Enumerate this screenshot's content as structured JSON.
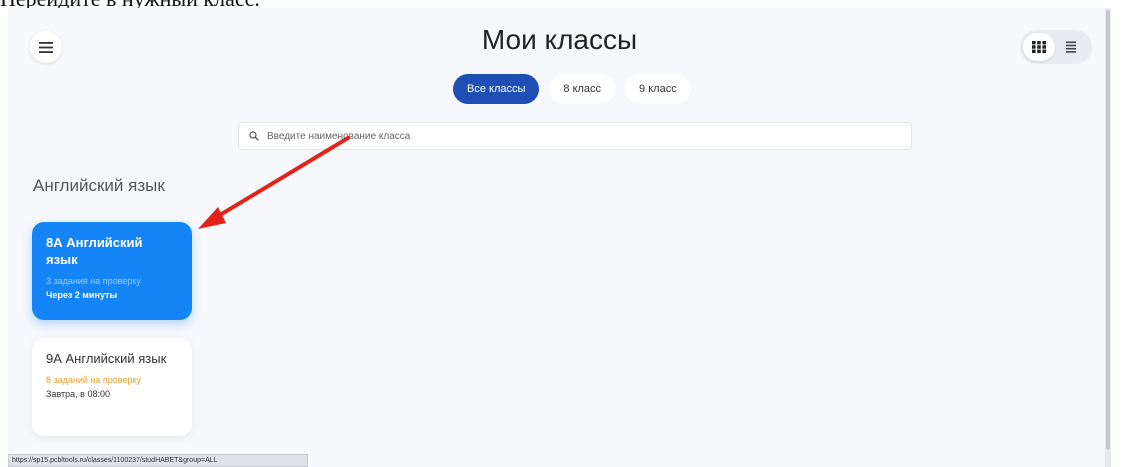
{
  "caption": "Перейдите в нужный класс.",
  "header": {
    "title": "Мои классы",
    "menu_icon": "hamburger-icon",
    "view_toggle": {
      "grid_icon": "grid-icon",
      "list_icon": "list-icon",
      "active": "grid"
    }
  },
  "tabs": [
    {
      "label": "Все классы",
      "active": true
    },
    {
      "label": "8 класс",
      "active": false
    },
    {
      "label": "9 класс",
      "active": false
    }
  ],
  "search": {
    "placeholder": "Введите наименование класса",
    "value": "",
    "icon": "search-icon"
  },
  "section": {
    "title": "Английский язык"
  },
  "cards": [
    {
      "title": "8А Английский язык",
      "tasks": "3 задания на проверку",
      "due": "Через 2 минуты",
      "color": "#1484f6"
    },
    {
      "title": "9А Английский язык",
      "tasks": "8 заданий на проверку",
      "due": "Завтра, в 08:00",
      "color": "#ffffff"
    }
  ],
  "annotation": {
    "arrow_color": "#e2231a"
  },
  "status_bar": {
    "url": "https://sp15.pcbltools.ru/classes/1100237/studHABET&group=ALL"
  },
  "colors": {
    "accent": "#1f4fb5",
    "card_blue": "#1484f6",
    "tasks_orange": "#e8a135",
    "background": "#f6f8fb"
  }
}
